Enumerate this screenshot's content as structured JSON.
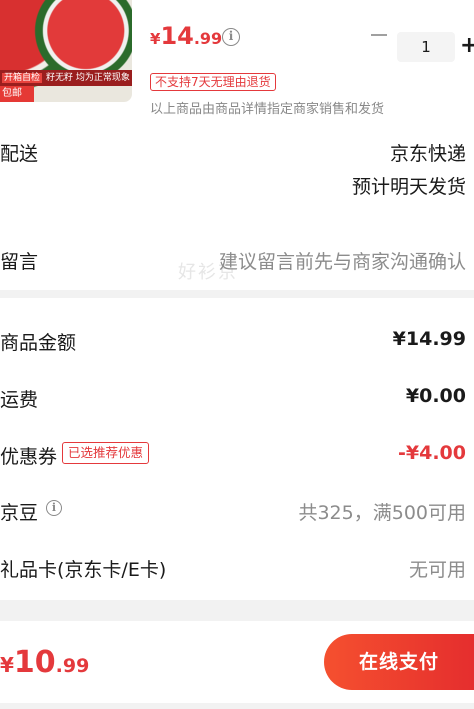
{
  "product": {
    "thumb_strip_tag": "开箱自检",
    "thumb_strip_text": "籽无籽 均为正常现象",
    "thumb_badge": "包邮",
    "price_symbol": "¥",
    "price_int": "14",
    "price_dec": ".99",
    "quantity": "1",
    "minus_icon": "minus-icon",
    "plus_symbol": "+",
    "return_tag": "不支持7天无理由退货",
    "seller_note": "以上商品由商品详情指定商家销售和发货"
  },
  "delivery": {
    "label": "配送",
    "carrier": "京东快递",
    "eta": "预计明天发货"
  },
  "message": {
    "label": "留言",
    "placeholder": "建议留言前先与商家沟通确认"
  },
  "watermark": "好衫京",
  "summary": {
    "goods_label": "商品金额",
    "goods_value": "¥14.99",
    "shipping_label": "运费",
    "shipping_value": "¥0.00",
    "coupon_label": "优惠券",
    "coupon_tag": "已选推荐优惠",
    "coupon_value": "-¥4.00",
    "beans_label": "京豆",
    "beans_value": "共325，满500可用",
    "giftcard_label": "礼品卡(京东卡/E卡)",
    "giftcard_value": "无可用"
  },
  "footer": {
    "total_symbol": "¥",
    "total_int": "10",
    "total_dec": ".99",
    "pay_label": "在线支付"
  },
  "colors": {
    "accent": "#e4393c",
    "pay_gradient_start": "#f5502f",
    "pay_gradient_end": "#e52e2e",
    "page_bg": "#f2f2f2"
  }
}
